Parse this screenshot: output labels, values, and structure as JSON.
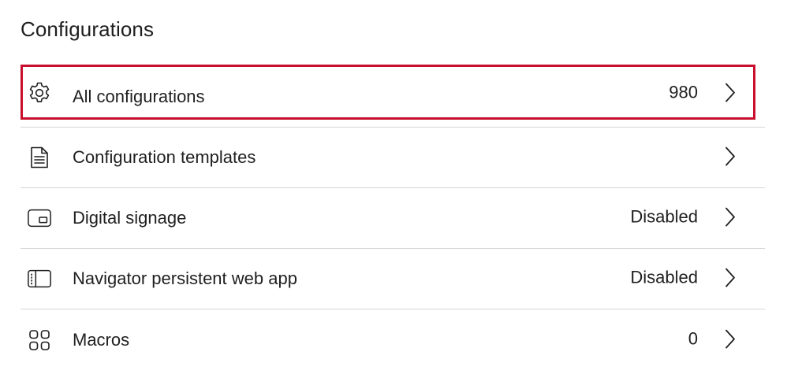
{
  "section": {
    "title": "Configurations"
  },
  "items": [
    {
      "label": "All configurations",
      "value": "980",
      "icon": "gear-icon",
      "highlighted": true
    },
    {
      "label": "Configuration templates",
      "value": "",
      "icon": "document-icon",
      "highlighted": false
    },
    {
      "label": "Digital signage",
      "value": "Disabled",
      "icon": "display-icon",
      "highlighted": false
    },
    {
      "label": "Navigator persistent web app",
      "value": "Disabled",
      "icon": "sidebar-panel-icon",
      "highlighted": false
    },
    {
      "label": "Macros",
      "value": "0",
      "icon": "grid-icon",
      "highlighted": false
    }
  ],
  "colors": {
    "highlight_border": "#c8102e",
    "divider": "#d4d4d4",
    "text": "#1f1f1f"
  }
}
